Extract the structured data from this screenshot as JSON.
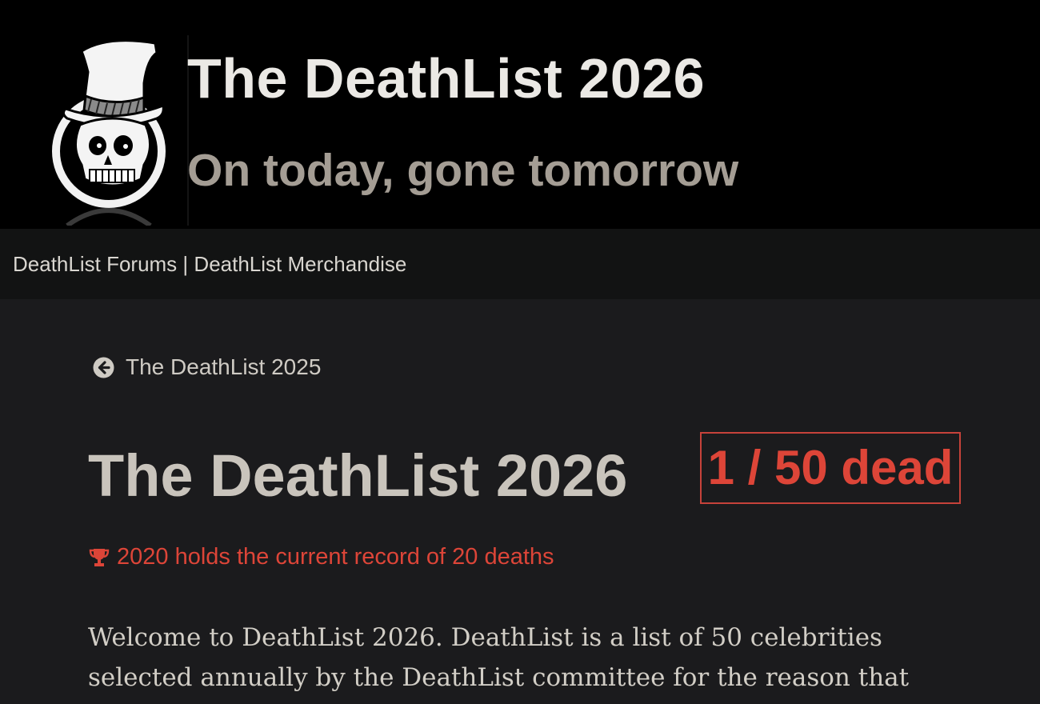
{
  "header": {
    "site_title": "The DeathList 2026",
    "tagline": "On today, gone tomorrow",
    "logo_icon": "skull-top-hat-icon"
  },
  "nav": {
    "forums_label": "DeathList Forums",
    "separator": "|",
    "merch_label": "DeathList Merchandise"
  },
  "main": {
    "back_link_label": "The DeathList 2025",
    "back_icon": "circle-arrow-left-icon",
    "page_title": "The DeathList 2026",
    "dead_counter": "1 / 50 dead",
    "record_icon": "trophy-icon",
    "record_text": "2020 holds the current record of 20 deaths",
    "intro_text": "Welcome to DeathList 2026. DeathList is a list of 50 celebrities selected annually by the DeathList committee for the reason that"
  },
  "colors": {
    "accent_red": "#dd4538",
    "masthead_bg": "#000000",
    "nav_bg": "#121313",
    "content_bg": "#1b1b1d"
  }
}
